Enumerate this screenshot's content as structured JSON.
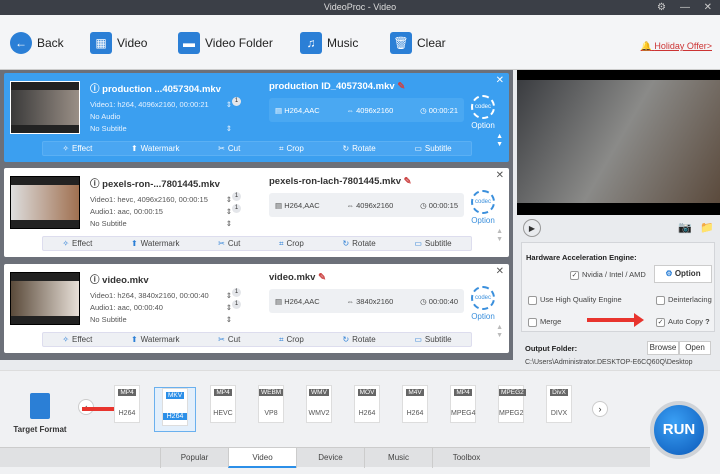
{
  "window": {
    "title": "VideoProc - Video"
  },
  "toolbar": {
    "back": "Back",
    "video": "Video",
    "video_folder": "Video Folder",
    "music": "Music",
    "clear": "Clear",
    "offer": "Holiday Offer>"
  },
  "actions": [
    "Effect",
    "Watermark",
    "Cut",
    "Crop",
    "Rotate",
    "Subtitle"
  ],
  "option_label": "Option",
  "codec_label": "codec",
  "items": [
    {
      "src_name": "production ...4057304.mkv",
      "video": "Video1: h264, 4096x2160, 00:00:21",
      "audio": "No Audio",
      "subtitle": "No Subtitle",
      "video_badge": "1",
      "audio_badge": "",
      "dst_name": "production ID_4057304.mkv",
      "codec": "H264,AAC",
      "resolution": "4096x2160",
      "duration": "00:00:21",
      "selected": true
    },
    {
      "src_name": "pexels-ron-...7801445.mkv",
      "video": "Video1: hevc, 4096x2160, 00:00:15",
      "audio": "Audio1: aac, 00:00:15",
      "subtitle": "No Subtitle",
      "video_badge": "1",
      "audio_badge": "1",
      "dst_name": "pexels-ron-lach-7801445.mkv",
      "codec": "H264,AAC",
      "resolution": "4096x2160",
      "duration": "00:00:15",
      "selected": false
    },
    {
      "src_name": "video.mkv",
      "video": "Video1: h264, 3840x2160, 00:00:40",
      "audio": "Audio1: aac, 00:00:40",
      "subtitle": "No Subtitle",
      "video_badge": "1",
      "audio_badge": "1",
      "dst_name": "video.mkv",
      "codec": "H264,AAC",
      "resolution": "3840x2160",
      "duration": "00:00:40",
      "selected": false
    }
  ],
  "settings": {
    "hw_title": "Hardware Acceleration Engine:",
    "hw_option": "Nvidia / Intel / AMD",
    "option_button": "Option",
    "high_quality": "Use High Quality Engine",
    "deinterlacing": "Deinterlacing",
    "merge": "Merge",
    "auto_copy": "Auto Copy",
    "help": "?",
    "output_label": "Output Folder:",
    "browse": "Browse",
    "open": "Open",
    "path": "C:\\Users\\Administrator.DESKTOP-E6CQ60Q\\Desktop"
  },
  "bottom": {
    "target_format": "Target Format",
    "run": "RUN",
    "formats": [
      {
        "tag": "MP4",
        "sub": "H264"
      },
      {
        "tag": "MKV",
        "sub": "H264"
      },
      {
        "tag": "MP4",
        "sub": "HEVC"
      },
      {
        "tag": "WEBM",
        "sub": "VP8"
      },
      {
        "tag": "WMV",
        "sub": "WMV2"
      },
      {
        "tag": "MOV",
        "sub": "H264"
      },
      {
        "tag": "M4V",
        "sub": "H264"
      },
      {
        "tag": "MP4",
        "sub": "MPEG4"
      },
      {
        "tag": "MPEG2",
        "sub": "MPEG2"
      },
      {
        "tag": "DivX",
        "sub": "DIVX"
      }
    ],
    "tabs": [
      "Popular",
      "Video",
      "Device",
      "Music",
      "Toolbox"
    ],
    "active_tab": "Video"
  }
}
